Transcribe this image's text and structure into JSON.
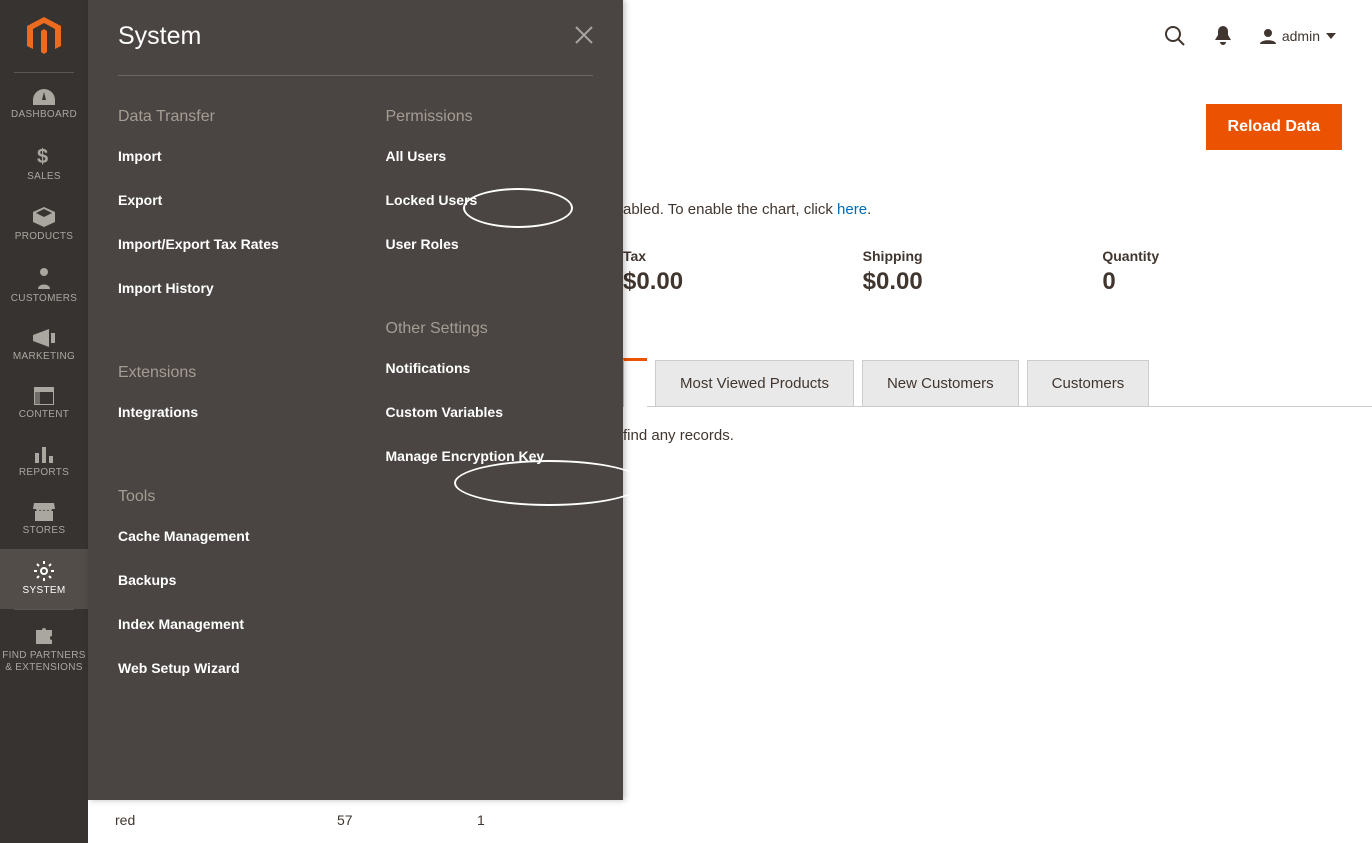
{
  "sidebar": {
    "items": [
      {
        "label": "DASHBOARD"
      },
      {
        "label": "SALES"
      },
      {
        "label": "PRODUCTS"
      },
      {
        "label": "CUSTOMERS"
      },
      {
        "label": "MARKETING"
      },
      {
        "label": "CONTENT"
      },
      {
        "label": "REPORTS"
      },
      {
        "label": "STORES"
      },
      {
        "label": "SYSTEM"
      },
      {
        "label": "FIND PARTNERS & EXTENSIONS"
      }
    ]
  },
  "flyout": {
    "title": "System",
    "column1": {
      "group1_title": "Data Transfer",
      "group1_items": [
        "Import",
        "Export",
        "Import/Export Tax Rates",
        "Import History"
      ],
      "group2_title": "Extensions",
      "group2_items": [
        "Integrations"
      ],
      "group3_title": "Tools",
      "group3_items": [
        "Cache Management",
        "Backups",
        "Index Management",
        "Web Setup Wizard"
      ]
    },
    "column2": {
      "group1_title": "Permissions",
      "group1_items": [
        "All Users",
        "Locked Users",
        "User Roles"
      ],
      "group2_title": "Other Settings",
      "group2_items": [
        "Notifications",
        "Custom Variables",
        "Manage Encryption Key"
      ]
    }
  },
  "header": {
    "username": "admin"
  },
  "page": {
    "reload_button": "Reload Data",
    "chart_notice_suffix": "abled. To enable the chart, click ",
    "chart_link": "here",
    "stats": [
      {
        "label": "Tax",
        "value": "$0.00"
      },
      {
        "label": "Shipping",
        "value": "$0.00"
      },
      {
        "label": "Quantity",
        "value": "0"
      }
    ],
    "tabs": [
      "Most Viewed Products",
      "New Customers",
      "Customers"
    ],
    "records_msg_suffix": "find any records.",
    "bottom_row": {
      "name": "red",
      "v1": "57",
      "v2": "1"
    }
  }
}
